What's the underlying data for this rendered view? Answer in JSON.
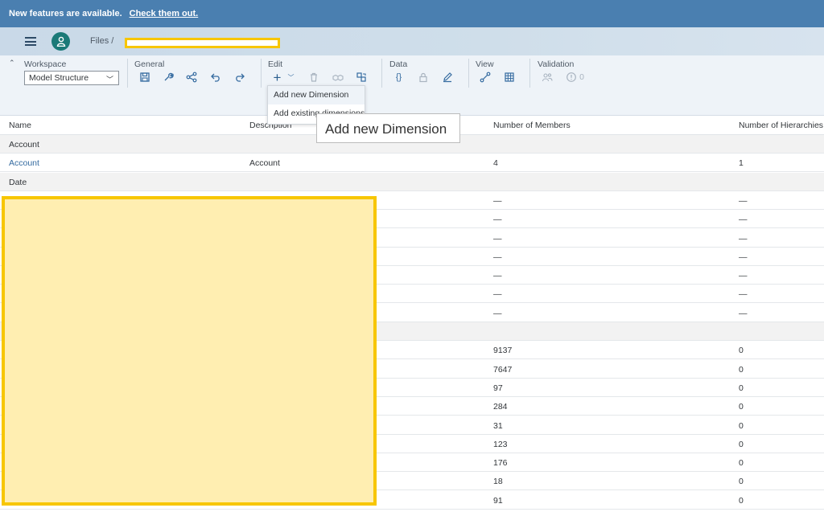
{
  "banner": {
    "message": "New features are available.",
    "link": "Check them out."
  },
  "shell": {
    "breadcrumb": "Files  /"
  },
  "toolbar": {
    "groups": {
      "workspace": "Workspace",
      "general": "General",
      "edit": "Edit",
      "data": "Data",
      "view": "View",
      "validation": "Validation"
    },
    "workspace_value": "Model Structure",
    "validation_count": "0",
    "add_menu": [
      "Add new Dimension",
      "Add existing dimensions"
    ],
    "tooltip": "Add new Dimension"
  },
  "table": {
    "headers": {
      "name": "Name",
      "description": "Description",
      "members": "Number of Members",
      "hierarchies": "Number of Hierarchies"
    },
    "rows": [
      {
        "type": "group",
        "name": "Account"
      },
      {
        "type": "data",
        "name": "Account",
        "description": "Account",
        "members": "4",
        "hierarchies": "1"
      },
      {
        "type": "group",
        "name": "Date"
      },
      {
        "type": "data",
        "members": "—",
        "hierarchies": "—"
      },
      {
        "type": "data",
        "members": "—",
        "hierarchies": "—"
      },
      {
        "type": "data",
        "members": "—",
        "hierarchies": "—"
      },
      {
        "type": "data",
        "members": "—",
        "hierarchies": "—"
      },
      {
        "type": "data",
        "members": "—",
        "hierarchies": "—"
      },
      {
        "type": "data",
        "members": "—",
        "hierarchies": "—"
      },
      {
        "type": "data",
        "members": "—",
        "hierarchies": "—"
      },
      {
        "type": "group",
        "name": ""
      },
      {
        "type": "data",
        "members": "9137",
        "hierarchies": "0"
      },
      {
        "type": "data",
        "members": "7647",
        "hierarchies": "0"
      },
      {
        "type": "data",
        "members": "97",
        "hierarchies": "0"
      },
      {
        "type": "data",
        "members": "284",
        "hierarchies": "0"
      },
      {
        "type": "data",
        "members": "31",
        "hierarchies": "0"
      },
      {
        "type": "data",
        "members": "123",
        "hierarchies": "0"
      },
      {
        "type": "data",
        "members": "176",
        "hierarchies": "0"
      },
      {
        "type": "data",
        "members": "18",
        "hierarchies": "0"
      },
      {
        "type": "data",
        "members": "91",
        "hierarchies": "0"
      }
    ]
  },
  "colors": {
    "banner": "#4a7fb0",
    "accent": "#356ba0",
    "avatar": "#1b7a78",
    "redaction": "#f7c600"
  }
}
